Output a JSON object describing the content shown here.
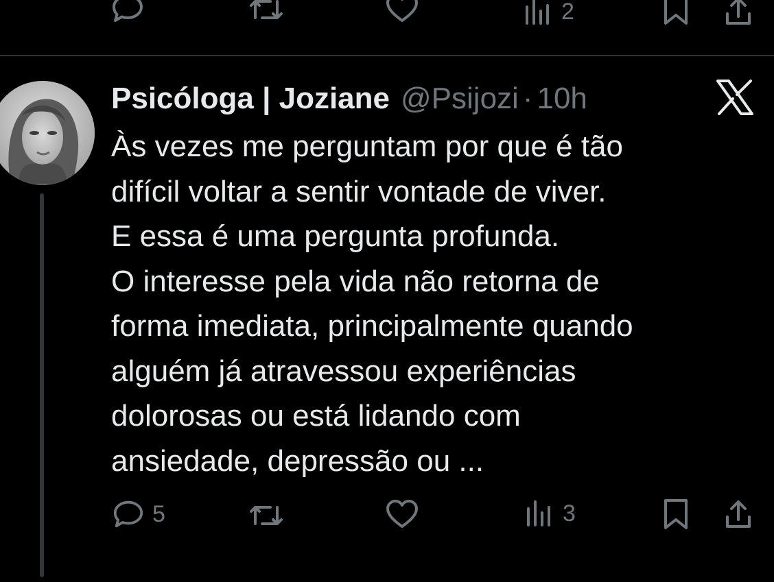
{
  "previous_tweet": {
    "actions": {
      "views_count": "2"
    }
  },
  "tweet": {
    "author": {
      "name": "Psicóloga | Joziane",
      "handle": "@Psijozi"
    },
    "separator": "·",
    "time": "10h",
    "text_lines": [
      "Às vezes me perguntam por que é tão",
      "difícil voltar a sentir vontade de viver.",
      "E essa é uma pergunta profunda.",
      "O interesse pela vida não retorna de",
      "forma imediata, principalmente quando",
      "alguém já atravessou experiências",
      "dolorosas ou está lidando com",
      "ansiedade, depressão ou ..."
    ],
    "actions": {
      "replies_count": "5",
      "views_count": "3"
    }
  },
  "icons": {
    "platform_logo": "x-logo-icon",
    "reply": "reply-icon",
    "retweet": "retweet-icon",
    "like": "heart-icon",
    "views": "views-icon",
    "bookmark": "bookmark-icon",
    "share": "share-icon"
  },
  "colors": {
    "background": "#000000",
    "text_primary": "#e7e9ea",
    "text_secondary": "#71767b",
    "divider": "#2f3336"
  }
}
